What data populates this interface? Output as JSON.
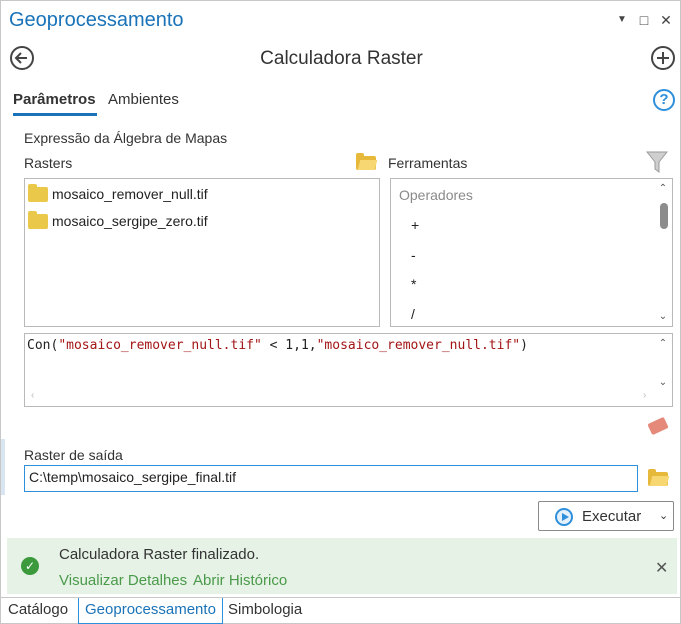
{
  "pane": {
    "title": "Geoprocessamento",
    "controls": {
      "menu": "▼",
      "maximize": "□",
      "close": "✕"
    }
  },
  "tool": {
    "title": "Calculadora Raster",
    "back_icon": "back-arrow-circle-icon",
    "add_icon": "plus-circle-icon"
  },
  "tabs": [
    {
      "label": "Parâmetros",
      "active": true
    },
    {
      "label": "Ambientes",
      "active": false
    }
  ],
  "help_glyph": "?",
  "expression": {
    "section_label": "Expressão da Álgebra de Mapas",
    "rasters_label": "Rasters",
    "rasters": [
      "mosaico_remover_null.tif",
      "mosaico_sergipe_zero.tif"
    ],
    "tools_label": "Ferramentas",
    "operators_header": "Operadores",
    "operators": [
      "+",
      "-",
      "*",
      "/"
    ],
    "expr_parts": {
      "p1": "Con(",
      "p2": "\"mosaico_remover_null.tif\"",
      "p3": " < 1,1,",
      "p4": "\"mosaico_remover_null.tif\"",
      "p5": ")"
    }
  },
  "output": {
    "label": "Raster de saída",
    "value": "C:\\temp\\mosaico_sergipe_final.tif"
  },
  "run_button": {
    "label": "Executar",
    "chevron": "⌄"
  },
  "notification": {
    "message": "Calculadora Raster finalizado.",
    "link_details": "Visualizar Detalhes",
    "link_history": "Abrir Histórico",
    "close": "✕",
    "check": "✓"
  },
  "bottom_tabs": [
    {
      "label": "Catálogo",
      "active": false
    },
    {
      "label": "Geoprocessamento",
      "active": true
    },
    {
      "label": "Simbologia",
      "active": false
    }
  ],
  "colors": {
    "accent": "#1a73b8",
    "success_bg": "#e6f2e6",
    "success_link": "#4a9a4a",
    "string_red": "#a31515"
  }
}
